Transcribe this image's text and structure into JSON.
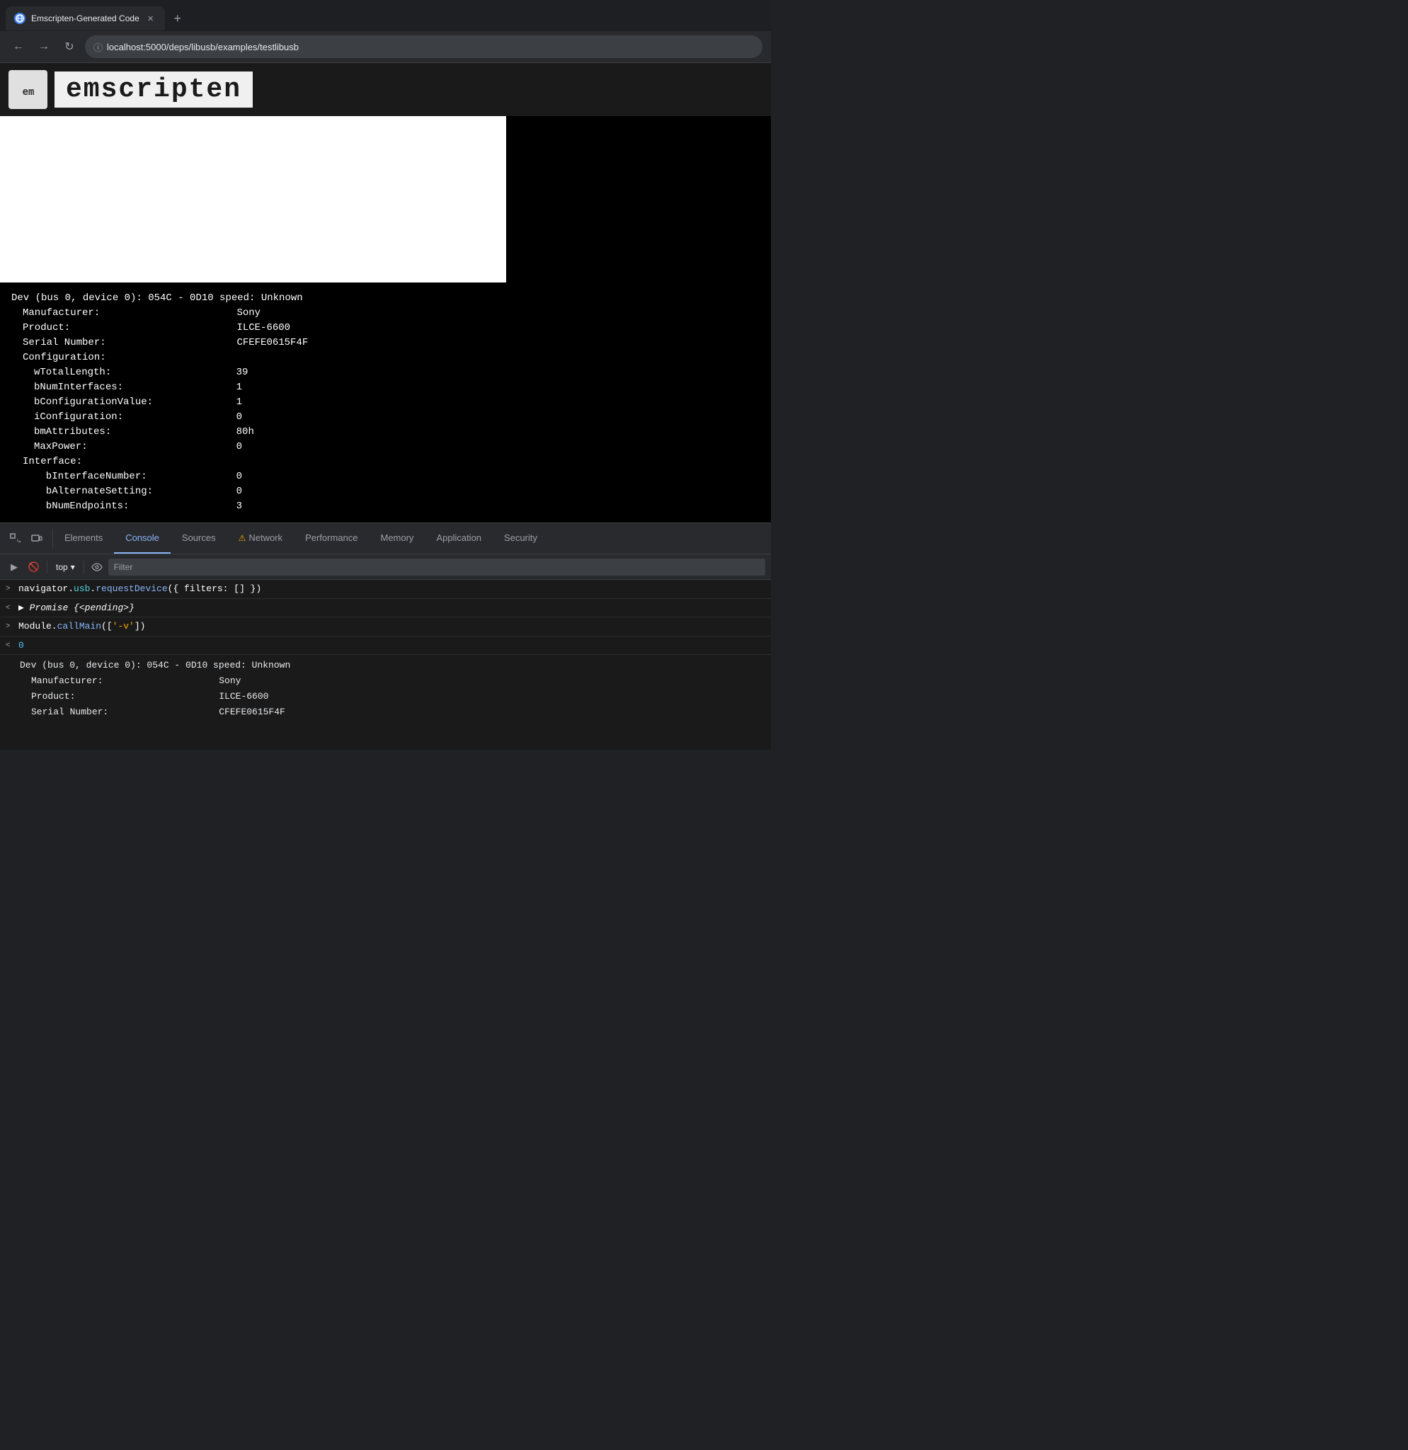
{
  "browser": {
    "tab": {
      "title": "Emscripten-Generated Code",
      "favicon": "🌐"
    },
    "new_tab_label": "+",
    "nav": {
      "back_label": "←",
      "forward_label": "→",
      "reload_label": "↻"
    },
    "address_bar": {
      "icon": "ⓘ",
      "url": "localhost:5000/deps/libusb/examples/testlibusb",
      "url_protocol": "localhost:",
      "url_path": "5000/deps/libusb/examples/testlibusb"
    }
  },
  "page": {
    "header": {
      "logo_text": "em",
      "title": "emscripten"
    }
  },
  "terminal": {
    "lines": [
      "Dev (bus 0, device 0): 054C - 0D10 speed: Unknown",
      "  Manufacturer:                       Sony",
      "  Product:                            ILCE-6600",
      "  Serial Number:                      CFEFE0615F4F",
      "  Configuration:",
      "    wTotalLength:                     39",
      "    bNumInterfaces:                   1",
      "    bConfigurationValue:              1",
      "    iConfiguration:                   0",
      "    bmAttributes:                     80h",
      "    MaxPower:                         0",
      "    Interface:",
      "      bInterfaceNumber:               0",
      "      bAlternateSetting:              0",
      "      bNumEndpoints:                  3"
    ]
  },
  "devtools": {
    "tabs": [
      {
        "id": "elements",
        "label": "Elements",
        "active": false,
        "warning": false
      },
      {
        "id": "console",
        "label": "Console",
        "active": true,
        "warning": false
      },
      {
        "id": "sources",
        "label": "Sources",
        "active": false,
        "warning": false
      },
      {
        "id": "network",
        "label": "Network",
        "active": false,
        "warning": true
      },
      {
        "id": "performance",
        "label": "Performance",
        "active": false,
        "warning": false
      },
      {
        "id": "memory",
        "label": "Memory",
        "active": false,
        "warning": false
      },
      {
        "id": "application",
        "label": "Application",
        "active": false,
        "warning": false
      },
      {
        "id": "security",
        "label": "Security",
        "active": false,
        "warning": false
      }
    ],
    "toolbar": {
      "run_label": "▶",
      "stop_label": "🚫",
      "context": "top",
      "context_arrow": "▾",
      "eye_label": "👁",
      "filter_placeholder": "Filter"
    },
    "console_lines": [
      {
        "arrow": ">",
        "type": "in",
        "parts": [
          {
            "text": "navigator.",
            "class": "white"
          },
          {
            "text": "usb",
            "class": "cyan"
          },
          {
            "text": ".",
            "class": "white"
          },
          {
            "text": "requestDevice",
            "class": "blue"
          },
          {
            "text": "({ filters: [] })",
            "class": "white"
          }
        ]
      },
      {
        "arrow": "<",
        "type": "out",
        "parts": [
          {
            "text": "▶ ",
            "class": "white"
          },
          {
            "text": "Promise {<pending>}",
            "class": "italic white"
          }
        ]
      },
      {
        "arrow": ">",
        "type": "in",
        "parts": [
          {
            "text": "Module",
            "class": "white"
          },
          {
            "text": ".",
            "class": "white"
          },
          {
            "text": "callMain",
            "class": "blue"
          },
          {
            "text": "([",
            "class": "white"
          },
          {
            "text": "'-v'",
            "class": "yellow"
          },
          {
            "text": "])",
            "class": "white"
          }
        ]
      },
      {
        "arrow": "<",
        "type": "out",
        "parts": [
          {
            "text": "0",
            "class": "num-blue"
          }
        ]
      }
    ],
    "device_output": {
      "lines": [
        "  Dev (bus 0, device 0): 054C - 0D10 speed: Unknown",
        "    Manufacturer:                     Sony",
        "    Product:                          ILCE-6600",
        "    Serial Number:                    CFEFE0615F4F"
      ]
    }
  },
  "colors": {
    "terminal_bg": "#000000",
    "terminal_text": "#ffffff",
    "devtools_bg": "#202124",
    "devtools_tab_active": "#8ab4f8",
    "console_bg": "#1a1a1a",
    "cyan": "#4dd0e1",
    "blue": "#8ab4f8",
    "yellow": "#f9ab00"
  }
}
